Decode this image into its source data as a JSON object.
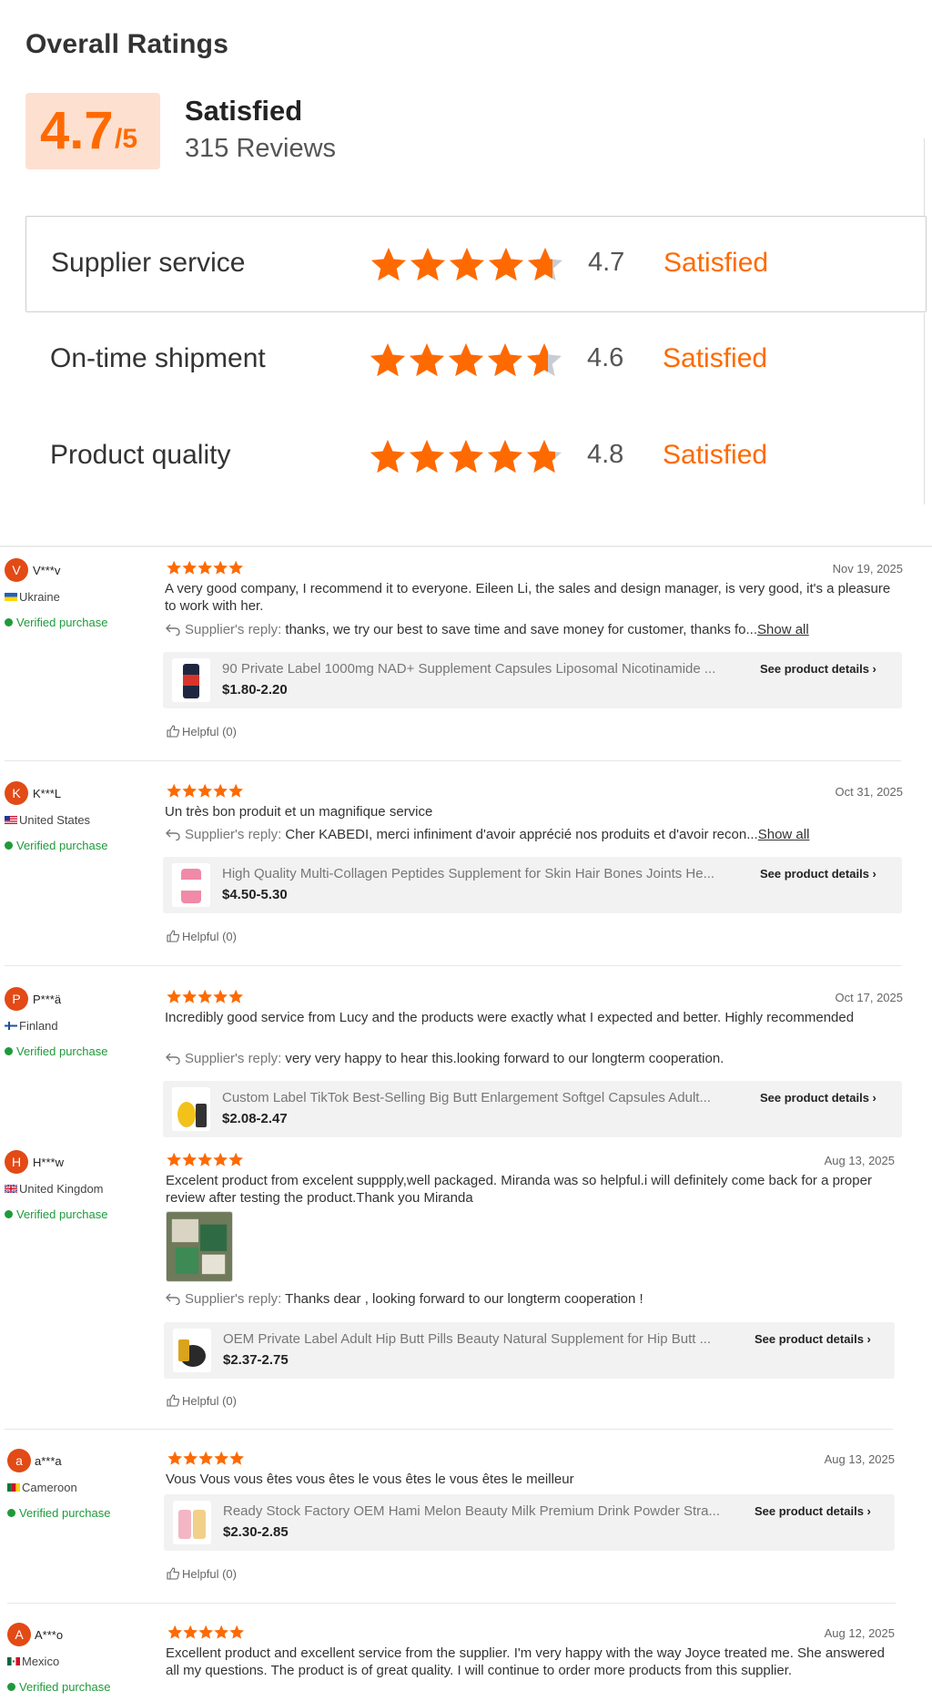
{
  "overall": {
    "title": "Overall Ratings",
    "score": "4.7",
    "score_suffix": "/5",
    "level": "Satisfied",
    "review_count": "315 Reviews",
    "dimensions": [
      {
        "label": "Supplier service",
        "value": "4.7",
        "rating": 4.7,
        "level": "Satisfied"
      },
      {
        "label": "On-time shipment",
        "value": "4.6",
        "rating": 4.6,
        "level": "Satisfied"
      },
      {
        "label": "Product quality",
        "value": "4.8",
        "rating": 4.8,
        "level": "Satisfied"
      }
    ]
  },
  "colors": {
    "accent": "#ff6a00",
    "score_bg": "#fde0d0",
    "verified": "#1f9a3a",
    "avatar": "#e24a16"
  },
  "labels": {
    "verified": "Verified purchase",
    "supplier_reply": "Supplier's reply:",
    "show_all": "Show all",
    "see_details": "See product details",
    "helpful": "Helpful (0)"
  },
  "reviews": [
    {
      "initial": "V",
      "name": "V***v",
      "country": "Ukraine",
      "rating": 5,
      "date": "Nov 19, 2025",
      "text": "A very good company, I recommend it to everyone. Eileen Li, the sales and design manager, is very good, it's a pleasure to work with her.",
      "reply": "thanks, we try our best to save time and save money for customer, thanks fo",
      "reply_more": "...",
      "product": {
        "title": "90 Private Label 1000mg NAD+ Supplement Capsules Liposomal Nicotinamide ...",
        "price": "$1.80-2.20"
      }
    },
    {
      "initial": "K",
      "name": "K***L",
      "country": "United States",
      "rating": 5,
      "date": "Oct 31, 2025",
      "text": "Un très bon produit et un magnifique service",
      "reply": "Cher KABEDI, merci infiniment d'avoir apprécié nos produits et d'avoir recon",
      "reply_more": "...",
      "product": {
        "title": "High Quality Multi-Collagen Peptides Supplement for Skin Hair Bones Joints He...",
        "price": "$4.50-5.30"
      }
    },
    {
      "initial": "P",
      "name": "P***ä",
      "country": "Finland",
      "rating": 5,
      "date": "Oct 17, 2025",
      "text": "Incredibly good service from Lucy and the products were exactly what I expected and better. Highly recommended",
      "reply": "very very happy to hear this.looking forward to our longterm cooperation.",
      "product": {
        "title": "Custom Label TikTok Best-Selling Big Butt Enlargement Softgel Capsules Adult...",
        "price": "$2.08-2.47"
      }
    },
    {
      "initial": "H",
      "name": "H***w",
      "country": "United Kingdom",
      "rating": 5,
      "date": "Aug 13, 2025",
      "text": "Excelent product from excelent suppply,well packaged. Miranda was so helpful.i will definitely come back for a proper review after testing the product.Thank you Miranda",
      "reply": "Thanks dear , looking forward to our longterm cooperation !",
      "product": {
        "title": "OEM Private Label Adult Hip Butt Pills Beauty Natural Supplement for Hip Butt ...",
        "price": "$2.37-2.75"
      }
    },
    {
      "initial": "a",
      "name": "a***a",
      "country": "Cameroon",
      "rating": 5,
      "date": "Aug 13, 2025",
      "text": "Vous Vous vous êtes vous êtes le vous êtes le vous êtes le meilleur",
      "product": {
        "title": "Ready Stock Factory OEM Hami Melon Beauty Milk Premium Drink Powder Stra...",
        "price": "$2.30-2.85"
      }
    },
    {
      "initial": "A",
      "name": "A***o",
      "country": "Mexico",
      "rating": 5,
      "date": "Aug 12, 2025",
      "text": "Excellent product and excellent service from the supplier. I'm very happy with the way Joyce treated me. She answered all my questions. The product is of great quality. I will continue to order more products from this supplier."
    }
  ]
}
